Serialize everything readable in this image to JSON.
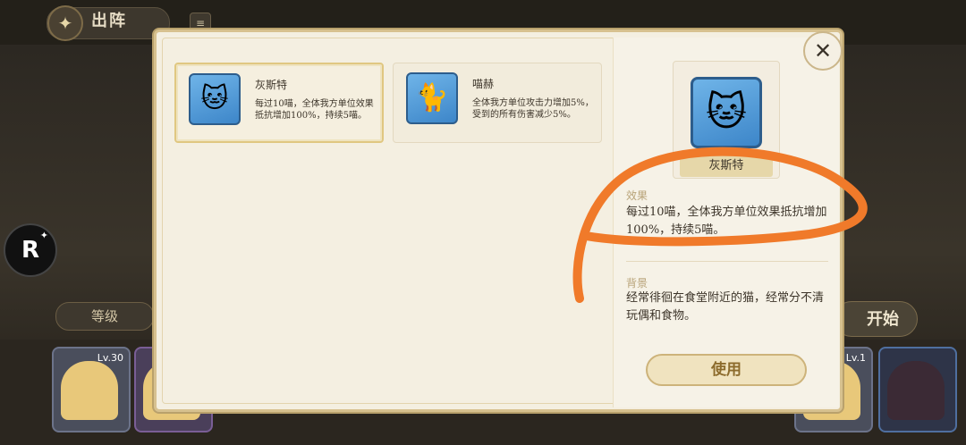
{
  "header": {
    "title": "出阵",
    "menu_icon": "book-icon"
  },
  "side": {
    "r_button_label": "R"
  },
  "lineup": {
    "level_label": "等级",
    "start_label": "开始",
    "cards": [
      {
        "level": "Lv.30"
      },
      {
        "level": ""
      },
      {
        "level": "Lv.1"
      },
      {
        "level": ""
      }
    ]
  },
  "modal": {
    "items": [
      {
        "name": "灰斯特",
        "desc": "每过10喵，全体我方单位效果抵抗增加100%，持续5喵。",
        "icon": "gray-cat-icon"
      },
      {
        "name": "喵赫",
        "desc": "全体我方单位攻击力增加5%，受到的所有伤害减少5%。",
        "icon": "white-cat-icon"
      }
    ],
    "detail": {
      "name": "灰斯特",
      "effect_label": "效果",
      "effect_text": "每过10喵，全体我方单位效果抵抗增加100%，持续5喵。",
      "background_label": "背景",
      "background_text": "经常徘徊在食堂附近的猫，经常分不清玩偶和食物。",
      "use_label": "使用"
    },
    "close_icon": "close-icon"
  },
  "colors": {
    "annotation": "#f07a2a",
    "accent": "#d7c18f"
  }
}
